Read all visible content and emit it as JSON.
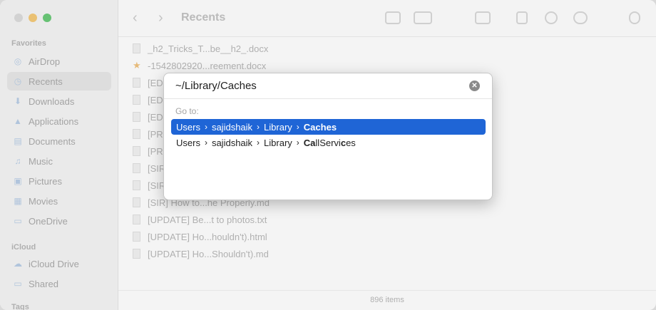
{
  "sidebar": {
    "sections": [
      {
        "label": "Favorites"
      },
      {
        "label": "iCloud"
      },
      {
        "label": "Tags"
      }
    ],
    "items": [
      {
        "label": "AirDrop",
        "icon": "airdrop-icon"
      },
      {
        "label": "Recents",
        "icon": "clock-icon",
        "active": true
      },
      {
        "label": "Downloads",
        "icon": "download-icon"
      },
      {
        "label": "Applications",
        "icon": "applications-icon"
      },
      {
        "label": "Documents",
        "icon": "document-icon"
      },
      {
        "label": "Music",
        "icon": "music-icon"
      },
      {
        "label": "Pictures",
        "icon": "pictures-icon"
      },
      {
        "label": "Movies",
        "icon": "movies-icon"
      },
      {
        "label": "OneDrive",
        "icon": "folder-icon"
      },
      {
        "label": "iCloud Drive",
        "icon": "cloud-icon"
      },
      {
        "label": "Shared",
        "icon": "shared-folder-icon"
      }
    ]
  },
  "toolbar": {
    "title": "Recents",
    "back": "‹",
    "forward": "›"
  },
  "files": [
    {
      "name": "_h2_Tricks_T...be__h2_.docx"
    },
    {
      "name": "-1542802920...reement.docx",
      "starred": true
    },
    {
      "name": "[EDI"
    },
    {
      "name": "[EDI"
    },
    {
      "name": "[EDI"
    },
    {
      "name": "[PR"
    },
    {
      "name": "[PR"
    },
    {
      "name": "[SIR"
    },
    {
      "name": "[SIR"
    },
    {
      "name": "[SIR] How to...he Properly.md"
    },
    {
      "name": "[UPDATE] Be...t to photos.txt"
    },
    {
      "name": "[UPDATE] Ho...houldn't).html"
    },
    {
      "name": "[UPDATE] Ho...Shouldn't).md"
    }
  ],
  "status": {
    "items_count": "896 items"
  },
  "dialog": {
    "path_value": "~/Library/Caches",
    "clear_glyph": "✕",
    "goto_label": "Go to:",
    "separator": "›",
    "suggestions": [
      {
        "crumbs": [
          "Users",
          "sajidshaik",
          "Library"
        ],
        "leaf": "Caches",
        "selected": true
      },
      {
        "crumbs": [
          "Users",
          "sajidshaik",
          "Library"
        ],
        "leaf_parts": [
          "Ca",
          "llServi",
          "c",
          "es"
        ],
        "selected": false
      }
    ]
  }
}
